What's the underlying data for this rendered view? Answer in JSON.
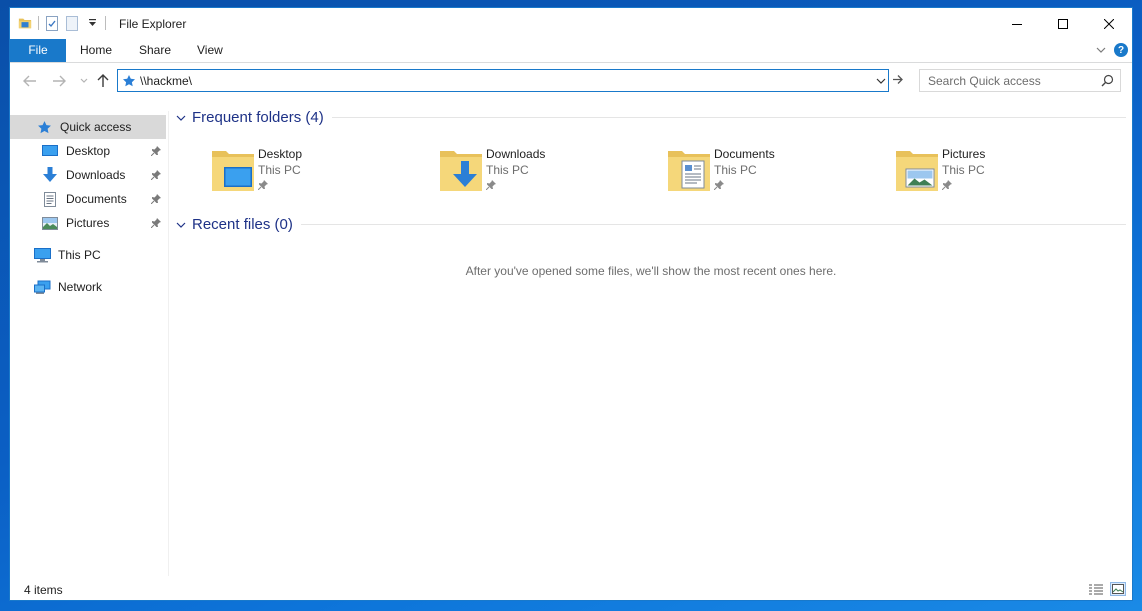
{
  "window": {
    "title": "File Explorer",
    "accent": "#1979ca"
  },
  "ribbon": {
    "tabs": [
      {
        "label": "File",
        "active": true
      },
      {
        "label": "Home"
      },
      {
        "label": "Share"
      },
      {
        "label": "View"
      }
    ]
  },
  "address": {
    "path": "\\\\hackme\\",
    "icon": "quick-access-star-icon"
  },
  "search": {
    "placeholder": "Search Quick access"
  },
  "nav": {
    "quick_access": "Quick access",
    "pinned": [
      {
        "label": "Desktop",
        "icon": "desktop-icon"
      },
      {
        "label": "Downloads",
        "icon": "downloads-icon"
      },
      {
        "label": "Documents",
        "icon": "documents-icon"
      },
      {
        "label": "Pictures",
        "icon": "pictures-icon"
      }
    ],
    "this_pc": "This PC",
    "network": "Network"
  },
  "frequent": {
    "header": "Frequent folders (4)",
    "folders": [
      {
        "name": "Desktop",
        "location": "This PC"
      },
      {
        "name": "Downloads",
        "location": "This PC"
      },
      {
        "name": "Documents",
        "location": "This PC"
      },
      {
        "name": "Pictures",
        "location": "This PC"
      }
    ]
  },
  "recent": {
    "header": "Recent files (0)",
    "empty_message": "After you've opened some files, we'll show the most recent ones here."
  },
  "status": {
    "items": "4 items"
  }
}
